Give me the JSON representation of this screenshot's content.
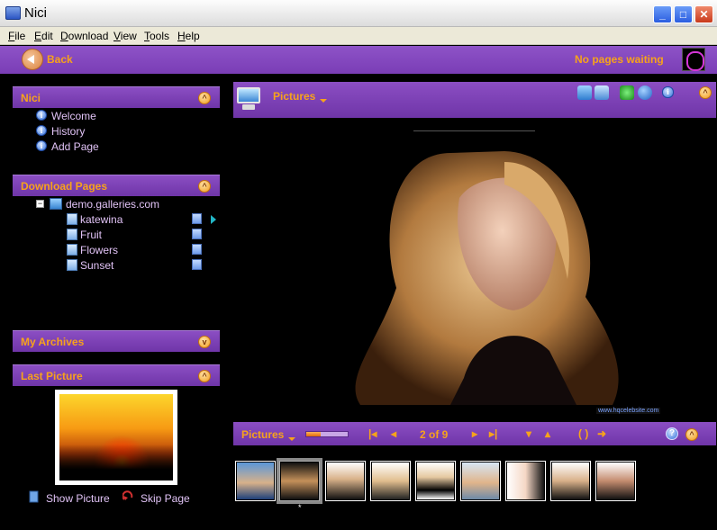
{
  "window": {
    "title": "Nici"
  },
  "menu": [
    "File",
    "Edit",
    "Download",
    "View",
    "Tools",
    "Help"
  ],
  "toolbar": {
    "back_label": "Back",
    "status": "No pages waiting"
  },
  "left": {
    "nici": {
      "title": "Nici",
      "items": [
        "Welcome",
        "History",
        "Add Page"
      ]
    },
    "download": {
      "title": "Download Pages",
      "site": "demo.galleries.com",
      "pages": [
        "katewina",
        "Fruit",
        "Flowers",
        "Sunset"
      ]
    },
    "archives": {
      "title": "My Archives"
    },
    "last_picture": {
      "title": "Last Picture",
      "show_label": "Show Picture",
      "skip_label": "Skip Page"
    }
  },
  "viewer": {
    "title": "Pictures",
    "watermark": "www.hqcelebsite.com",
    "nav_label": "Pictures",
    "page_count": "2 of 9",
    "progress": 0.35,
    "thumbnails": 9,
    "selected_index": 1,
    "selected_marker": "*"
  },
  "colors": {
    "accent": "#f7a31b",
    "panel": "#7a3db6",
    "link": "#e0c2f5"
  }
}
